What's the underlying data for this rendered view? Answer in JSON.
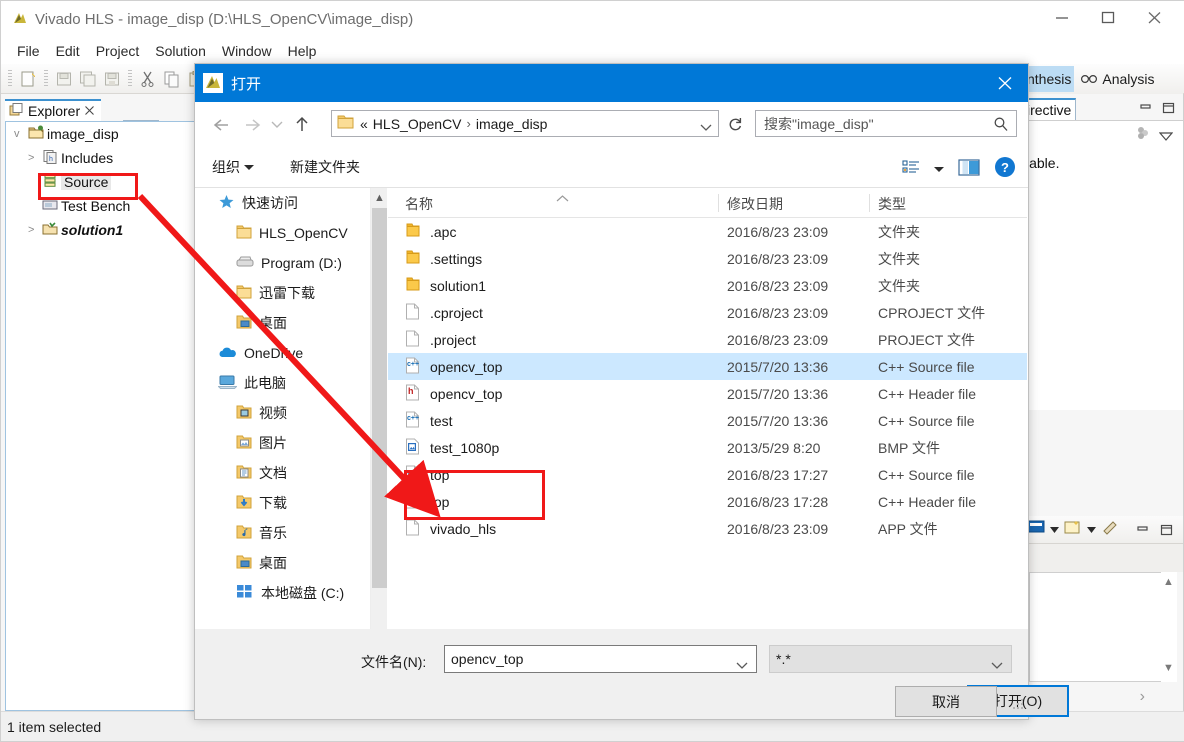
{
  "ide": {
    "title": "Vivado HLS - image_disp (D:\\HLS_OpenCV\\image_disp)",
    "logo_icon": "vivado-logo-icon",
    "window_controls": {
      "minimize": "minimize-icon",
      "maximize": "maximize-icon",
      "close": "close-icon"
    },
    "menu": [
      {
        "label": "File"
      },
      {
        "label": "Edit"
      },
      {
        "label": "Project"
      },
      {
        "label": "Solution"
      },
      {
        "label": "Window"
      },
      {
        "label": "Help"
      }
    ],
    "toolbar_icons": [
      "new-file-icon",
      "save-icon",
      "save-all-icon",
      "save-as-icon",
      "cut-icon",
      "copy-icon",
      "paste-icon",
      "delete-icon"
    ],
    "perspective_tabs": [
      {
        "label": "Synthesis",
        "visible_text": "nthesis",
        "active": true
      },
      {
        "label": "Analysis",
        "visible_text": "Analysis",
        "icon": "glasses-icon",
        "active": false
      }
    ],
    "explorer": {
      "tab_label": "Explorer",
      "tab_icon": "explorer-icon",
      "tab_close_icon": "close-tab-icon",
      "tree": [
        {
          "label": "image_disp",
          "icon": "project-folder-icon",
          "twisty": "v",
          "level": 0,
          "selected": false,
          "style": "normal"
        },
        {
          "label": "Includes",
          "icon": "includes-icon",
          "twisty": ">",
          "level": 1,
          "selected": false,
          "style": "normal"
        },
        {
          "label": "Source",
          "icon": "source-folder-icon",
          "twisty": "",
          "level": 1,
          "selected": true,
          "style": "normal"
        },
        {
          "label": "Test Bench",
          "icon": "testbench-icon",
          "twisty": "",
          "level": 1,
          "selected": false,
          "style": "normal"
        },
        {
          "label": "solution1",
          "icon": "solution-folder-icon",
          "twisty": ">",
          "level": 1,
          "selected": false,
          "style": "bolditalic"
        }
      ]
    },
    "directive_view": {
      "tab_label": "Directive",
      "visible_text": "irective",
      "minimize_icon": "minimize-view-icon",
      "maximize_icon": "maximize-view-icon",
      "body_text": "lable.",
      "tool_icon": "link-dots-icon",
      "menu_icon": "view-menu-icon"
    },
    "console_view": {
      "toolbar_icons": [
        "console-display-icon",
        "dropdown-caret-icon",
        "open-console-icon",
        "dropdown-caret-icon",
        "clear-console-icon"
      ],
      "minimize_icon": "minimize-view-icon",
      "maximize_icon": "maximize-view-icon",
      "scroll_up_icon": "scroll-up-icon",
      "scroll_down_icon": "scroll-down-icon",
      "next_icon": "next-icon"
    },
    "statusbar": {
      "text": "1 item selected"
    }
  },
  "dialog": {
    "title": "打开",
    "title_icon": "vivado-logo-icon",
    "close_icon": "close-icon",
    "nav": {
      "back_icon": "back-arrow-icon",
      "forward_icon": "forward-arrow-icon",
      "recent_icon": "recent-locations-icon",
      "up_icon": "up-arrow-icon",
      "address_folder_icon": "folder-icon",
      "breadcrumbs": [
        "«",
        "HLS_OpenCV",
        "image_disp"
      ],
      "address_dropdown_icon": "chevron-down-icon",
      "refresh_icon": "refresh-icon",
      "search_placeholder": "搜索\"image_disp\"",
      "search_icon": "search-icon"
    },
    "commandbar": {
      "organize_label": "组织",
      "organize_caret": "caret-down-icon",
      "new_folder_label": "新建文件夹",
      "view_layout_icon": "view-layout-icon",
      "view_caret": "caret-down-icon",
      "preview_pane_icon": "preview-pane-icon",
      "help_icon": "help-icon"
    },
    "places": [
      {
        "label": "快速访问",
        "icon": "quick-access-star-icon",
        "level": 0
      },
      {
        "label": "HLS_OpenCV",
        "icon": "folder-icon",
        "level": 1
      },
      {
        "label": "Program (D:)",
        "icon": "drive-icon",
        "level": 1
      },
      {
        "label": "迅雷下载",
        "icon": "folder-icon",
        "level": 1
      },
      {
        "label": "桌面",
        "icon": "desktop-folder-icon",
        "level": 1
      },
      {
        "label": "OneDrive",
        "icon": "onedrive-icon",
        "level": 0
      },
      {
        "label": "此电脑",
        "icon": "this-pc-icon",
        "level": 0
      },
      {
        "label": "视频",
        "icon": "videos-folder-icon",
        "level": 1
      },
      {
        "label": "图片",
        "icon": "pictures-folder-icon",
        "level": 1
      },
      {
        "label": "文档",
        "icon": "documents-folder-icon",
        "level": 1
      },
      {
        "label": "下载",
        "icon": "downloads-folder-icon",
        "level": 1
      },
      {
        "label": "音乐",
        "icon": "music-folder-icon",
        "level": 1
      },
      {
        "label": "桌面",
        "icon": "desktop-folder-icon",
        "level": 1
      },
      {
        "label": "本地磁盘 (C:)",
        "icon": "local-disk-icon",
        "level": 1
      }
    ],
    "columns": [
      {
        "label": "名称"
      },
      {
        "label": "修改日期"
      },
      {
        "label": "类型"
      }
    ],
    "files": [
      {
        "name": ".apc",
        "date": "2016/8/23 23:09",
        "type": "文件夹",
        "icon": "folder-icon",
        "selected": false
      },
      {
        "name": ".settings",
        "date": "2016/8/23 23:09",
        "type": "文件夹",
        "icon": "folder-icon",
        "selected": false
      },
      {
        "name": "solution1",
        "date": "2016/8/23 23:09",
        "type": "文件夹",
        "icon": "folder-icon",
        "selected": false
      },
      {
        "name": ".cproject",
        "date": "2016/8/23 23:09",
        "type": "CPROJECT 文件",
        "icon": "generic-file-icon",
        "selected": false
      },
      {
        "name": ".project",
        "date": "2016/8/23 23:09",
        "type": "PROJECT 文件",
        "icon": "generic-file-icon",
        "selected": false
      },
      {
        "name": "opencv_top",
        "date": "2015/7/20 13:36",
        "type": "C++ Source file",
        "icon": "cpp-source-icon",
        "selected": true
      },
      {
        "name": "opencv_top",
        "date": "2015/7/20 13:36",
        "type": "C++ Header file",
        "icon": "cpp-header-icon",
        "selected": false
      },
      {
        "name": "test",
        "date": "2015/7/20 13:36",
        "type": "C++ Source file",
        "icon": "cpp-source-icon",
        "selected": false
      },
      {
        "name": "test_1080p",
        "date": "2013/5/29 8:20",
        "type": "BMP 文件",
        "icon": "bmp-file-icon",
        "selected": false
      },
      {
        "name": "top",
        "date": "2016/8/23 17:27",
        "type": "C++ Source file",
        "icon": "cpp-source-icon",
        "selected": false
      },
      {
        "name": "top",
        "date": "2016/8/23 17:28",
        "type": "C++ Header file",
        "icon": "cpp-header-icon",
        "selected": false
      },
      {
        "name": "vivado_hls",
        "date": "2016/8/23 23:09",
        "type": "APP 文件",
        "icon": "generic-file-icon",
        "selected": false
      }
    ],
    "footer": {
      "filename_label": "文件名(N):",
      "filename_value": "opencv_top",
      "filename_caret": "chevron-down-icon",
      "filter_value": "*.*",
      "filter_caret": "chevron-down-icon",
      "open_button": "打开(O)",
      "cancel_button": "取消",
      "resize_grip_icon": "resize-grip-icon"
    },
    "scrollbars": {
      "places_up_icon": "scroll-up-icon",
      "places_down_icon": "scroll-down-icon",
      "hscroll_left_icon": "scroll-left-icon",
      "hscroll_right_icon": "scroll-right-icon"
    }
  },
  "annotations": {
    "color": "#f01818",
    "highlight_source_tree_item": "Source",
    "highlight_top_files": "top",
    "arrow": "red-arrow-pointing-from-source-to-top-files"
  }
}
